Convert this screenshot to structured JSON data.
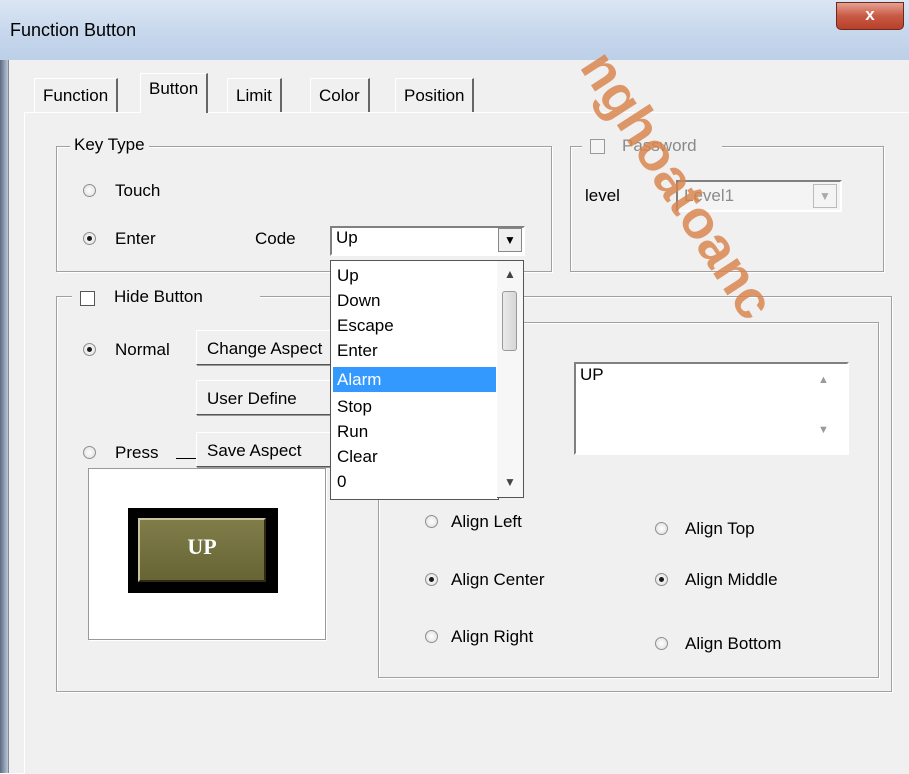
{
  "window": {
    "title": "Function Button",
    "close_label": "x"
  },
  "tabs": [
    {
      "label": "Function",
      "active": false
    },
    {
      "label": "Button",
      "active": true
    },
    {
      "label": "Limit",
      "active": false
    },
    {
      "label": "Color",
      "active": false
    },
    {
      "label": "Position",
      "active": false
    }
  ],
  "key_type": {
    "legend": "Key Type",
    "touch_label": "Touch",
    "enter_label": "Enter",
    "selected": "Enter",
    "code_label": "Code",
    "code_value": "Up",
    "code_options": [
      "Up",
      "Down",
      "Escape",
      "Enter",
      "Alarm",
      "Stop",
      "Run",
      "Clear",
      "0"
    ],
    "highlighted_option": "Alarm"
  },
  "password": {
    "label": "Password",
    "checked": false,
    "enabled": false,
    "level_label": "level",
    "level_value": "Level1"
  },
  "hide_button": {
    "label": "Hide Button",
    "checked": false
  },
  "aspect": {
    "normal_label": "Normal",
    "press_label": "Press",
    "selected": "Normal",
    "change_aspect": "Change Aspect",
    "user_define": "User Define",
    "save_aspect": "Save Aspect"
  },
  "preview": {
    "text": "UP"
  },
  "text_settings": {
    "text_value": "UP",
    "align_left": "Align Left",
    "align_center": "Align Center",
    "align_right": "Align Right",
    "align_top": "Align Top",
    "align_middle": "Align Middle",
    "align_bottom": "Align Bottom",
    "horizontal_selected": "Align Center",
    "vertical_selected": "Align Middle"
  },
  "watermark": {
    "text": "nghoatoanc"
  },
  "colors": {
    "selection": "#3399ff",
    "titlebar": "#c7d7ec",
    "close_button": "#c85a44",
    "watermark": "#d9834a",
    "preview_button": "#6e6b3c"
  }
}
